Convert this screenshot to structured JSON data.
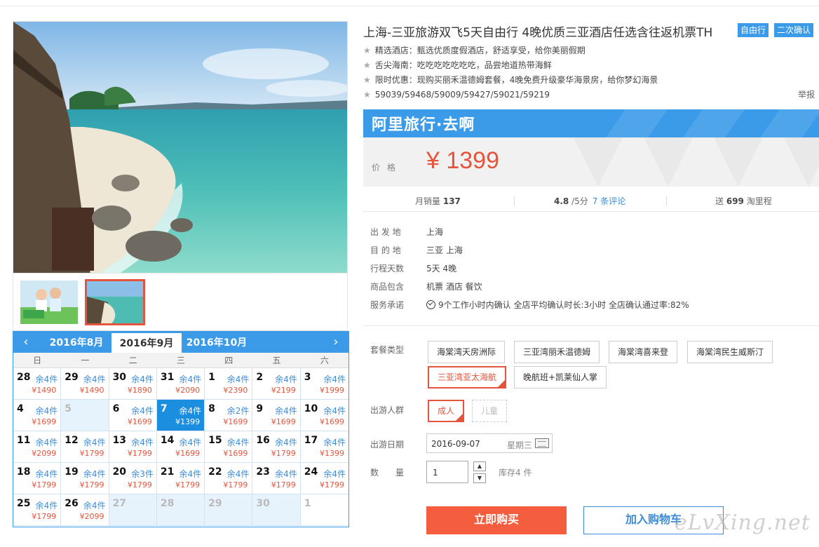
{
  "product": {
    "title": "上海-三亚旅游双飞5天自由行 4晚优质三亚酒店任选含往返机票TH",
    "tags": [
      "自由行",
      "二次确认"
    ],
    "features": [
      "精选酒店：甄选优质度假酒店，舒适享受，给你美丽假期",
      "舌尖海南：吃吃吃吃吃吃吃，品尝地道热带海鲜",
      "限时优惠：现购买丽禾温德姆套餐，4晚免费升级豪华海景房，给你梦幻海景",
      "59039/59468/59009/59427/59021/59219"
    ],
    "report_label": "举报"
  },
  "banner": {
    "brand": "阿里旅行·去啊",
    "color": "#3c9be8"
  },
  "price": {
    "label": "价格",
    "value": "¥ 1399",
    "color": "#e4553c"
  },
  "stats": {
    "sales_label": "月销量",
    "sales_value": "137",
    "rating_value": "4.8",
    "rating_suffix": "/5分",
    "reviews_link": "7 条评论",
    "points_prefix": "送",
    "points_value": "699",
    "points_suffix": "淘里程"
  },
  "info": [
    {
      "label": "出 发 地",
      "value": "上海"
    },
    {
      "label": "目 的 地",
      "value": "三亚   上海"
    },
    {
      "label": "行程天数",
      "value": "5天 4晚"
    },
    {
      "label": "商品包含",
      "value": "机票   酒店   餐饮"
    },
    {
      "label": "服务承诺",
      "value": "9个工作小时内确认     全店平均确认时长:3小时     全店确认通过率:82%"
    }
  ],
  "options": {
    "package_label": "套餐类型",
    "packages": [
      "海棠湾天房洲际",
      "三亚湾丽禾温德姆",
      "海棠湾喜来登",
      "海棠湾民生威斯汀",
      "三亚湾亚太海航",
      "晚航班+凯莱仙人掌"
    ],
    "selected_package": "三亚湾亚太海航",
    "traveler_label": "出游人群",
    "travelers": [
      "成人",
      "儿童"
    ],
    "date_label": "出游日期",
    "date_value": "2016-09-07",
    "date_weekday": "星期三",
    "qty_label": "数　　量",
    "qty_value": "1",
    "stock_note": "库存4 件"
  },
  "actions": {
    "buy": "立即购买",
    "cart": "加入购物车"
  },
  "watermark": "eLvXing.net",
  "calendar": {
    "prev_icon": "chevron-left-icon",
    "next_icon": "chevron-right-icon",
    "months": [
      "2016年8月",
      "2016年9月",
      "2016年10月"
    ],
    "active_month": "2016年9月",
    "weekdays": [
      "日",
      "一",
      "二",
      "三",
      "四",
      "五",
      "六"
    ],
    "cells": [
      {
        "day": "28",
        "stock": "余4件",
        "price": "¥1490"
      },
      {
        "day": "29",
        "stock": "余4件",
        "price": "¥1490"
      },
      {
        "day": "30",
        "stock": "余4件",
        "price": "¥1890"
      },
      {
        "day": "31",
        "stock": "余4件",
        "price": "¥2090"
      },
      {
        "day": "1",
        "stock": "余4件",
        "price": "¥2390"
      },
      {
        "day": "2",
        "stock": "余4件",
        "price": "¥2199"
      },
      {
        "day": "3",
        "stock": "余4件",
        "price": "¥1999"
      },
      {
        "day": "4",
        "stock": "余4件",
        "price": "¥1699"
      },
      {
        "day": "5",
        "stock": "",
        "price": "",
        "inactive": true
      },
      {
        "day": "6",
        "stock": "余4件",
        "price": "¥1699"
      },
      {
        "day": "7",
        "stock": "余4件",
        "price": "¥1399",
        "selected": true
      },
      {
        "day": "8",
        "stock": "余2件",
        "price": "¥1699"
      },
      {
        "day": "9",
        "stock": "余4件",
        "price": "¥1699"
      },
      {
        "day": "10",
        "stock": "余4件",
        "price": "¥1699"
      },
      {
        "day": "11",
        "stock": "余4件",
        "price": "¥2099"
      },
      {
        "day": "12",
        "stock": "余4件",
        "price": "¥1799"
      },
      {
        "day": "13",
        "stock": "余4件",
        "price": "¥1799"
      },
      {
        "day": "14",
        "stock": "余4件",
        "price": "¥1699"
      },
      {
        "day": "15",
        "stock": "余4件",
        "price": "¥1699"
      },
      {
        "day": "16",
        "stock": "余4件",
        "price": "¥1799"
      },
      {
        "day": "17",
        "stock": "余4件",
        "price": "¥1399"
      },
      {
        "day": "18",
        "stock": "余4件",
        "price": "¥1799"
      },
      {
        "day": "19",
        "stock": "余4件",
        "price": "¥1799"
      },
      {
        "day": "20",
        "stock": "余3件",
        "price": "¥1799"
      },
      {
        "day": "21",
        "stock": "余4件",
        "price": "¥1799"
      },
      {
        "day": "22",
        "stock": "余4件",
        "price": "¥1799"
      },
      {
        "day": "23",
        "stock": "余4件",
        "price": "¥1799"
      },
      {
        "day": "24",
        "stock": "余4件",
        "price": "¥1799"
      },
      {
        "day": "25",
        "stock": "余4件",
        "price": "¥1799"
      },
      {
        "day": "26",
        "stock": "余4件",
        "price": "¥2099"
      },
      {
        "day": "27",
        "stock": "",
        "price": "",
        "inactive": true
      },
      {
        "day": "28",
        "stock": "",
        "price": "",
        "inactive": true
      },
      {
        "day": "29",
        "stock": "",
        "price": "",
        "inactive": true
      },
      {
        "day": "30",
        "stock": "",
        "price": "",
        "inactive": true
      },
      {
        "day": "1",
        "stock": "",
        "price": "",
        "nextmonth": true
      }
    ]
  }
}
